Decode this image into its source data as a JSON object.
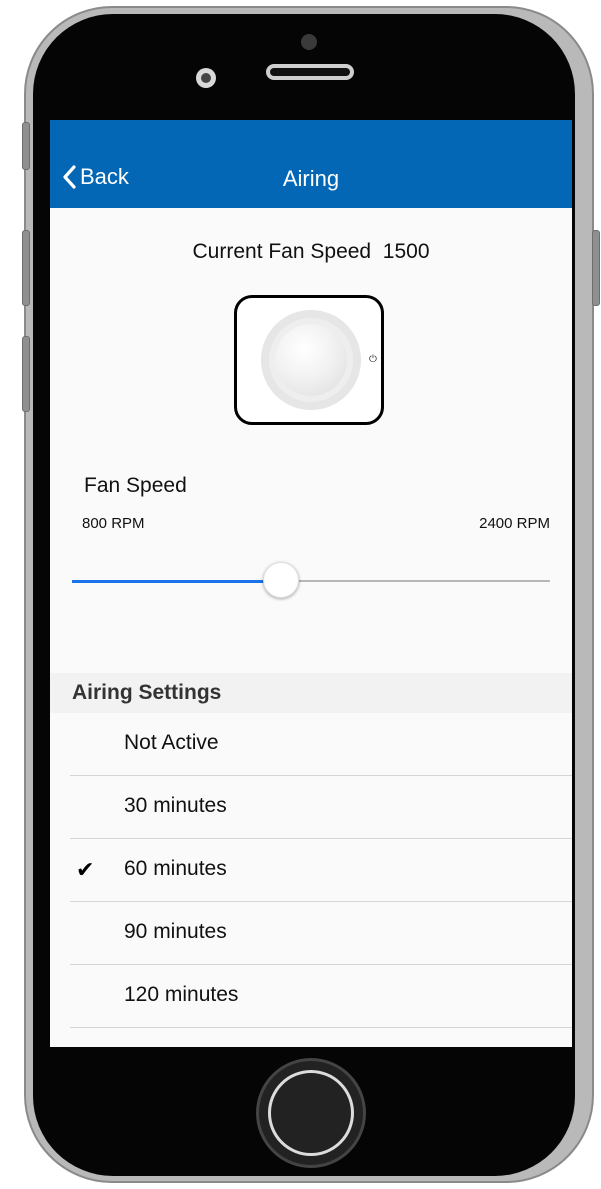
{
  "header": {
    "back_label": "Back",
    "title": "Airing"
  },
  "fan": {
    "current_speed_label": "Current Fan Speed",
    "current_speed_value": "1500"
  },
  "slider": {
    "section_label": "Fan Speed",
    "min_label": "800 RPM",
    "max_label": "2400 RPM",
    "min": 800,
    "max": 2400,
    "value": 1500,
    "accent_color": "#1a73e8"
  },
  "airing": {
    "header": "Airing Settings",
    "options": [
      {
        "label": "Not Active",
        "selected": false
      },
      {
        "label": "30  minutes",
        "selected": false
      },
      {
        "label": "60  minutes",
        "selected": true
      },
      {
        "label": "90  minutes",
        "selected": false
      },
      {
        "label": "120  minutes",
        "selected": false
      }
    ]
  },
  "colors": {
    "navbar": "#0367b5"
  },
  "icons": {
    "back": "chevron-left-icon",
    "check": "checkmark-icon",
    "device": "fan-icon"
  }
}
